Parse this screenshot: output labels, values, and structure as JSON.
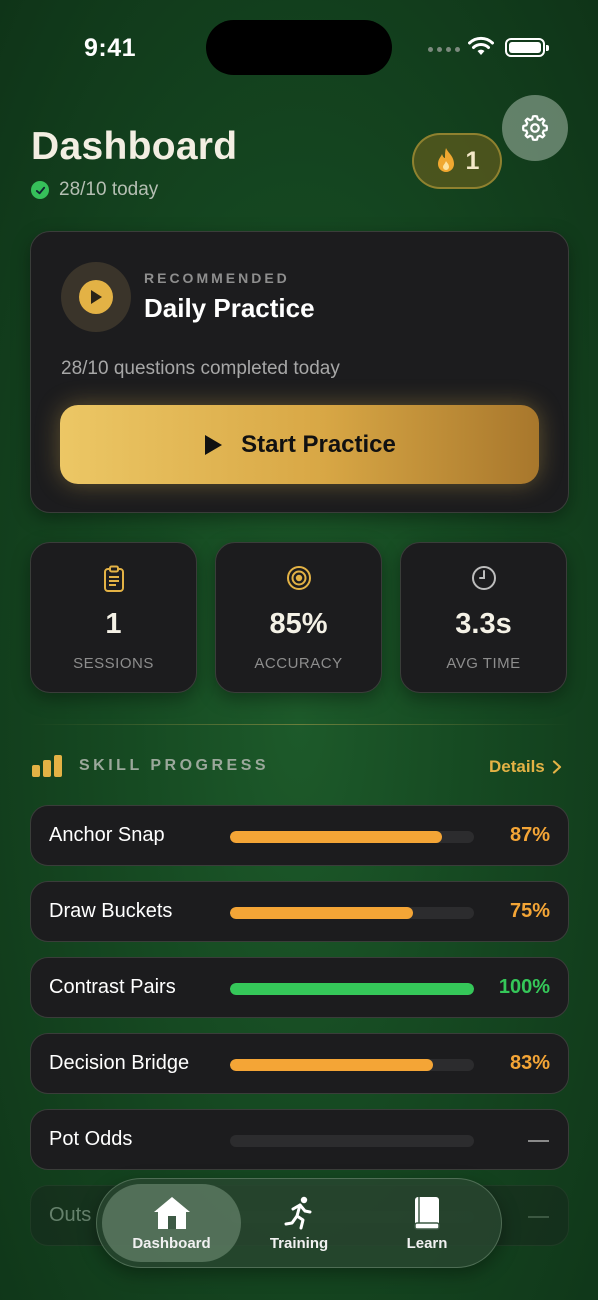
{
  "status_bar": {
    "time": "9:41"
  },
  "header": {
    "title": "Dashboard",
    "subtitle": "28/10 today",
    "streak_count": "1"
  },
  "recommended": {
    "eyebrow": "RECOMMENDED",
    "title": "Daily Practice",
    "description": "28/10 questions completed today",
    "button_label": "Start Practice"
  },
  "stats": [
    {
      "icon": "clipboard-icon",
      "value": "1",
      "label": "SESSIONS"
    },
    {
      "icon": "target-icon",
      "value": "85%",
      "label": "ACCURACY"
    },
    {
      "icon": "clock-icon",
      "value": "3.3s",
      "label": "AVG TIME"
    }
  ],
  "skill_progress": {
    "heading": "SKILL PROGRESS",
    "details_label": "Details",
    "skills": [
      {
        "name": "Anchor Snap",
        "progress": 0.87,
        "value": "87%",
        "color": "#f4a536"
      },
      {
        "name": "Draw Buckets",
        "progress": 0.75,
        "value": "75%",
        "color": "#f4a536"
      },
      {
        "name": "Contrast Pairs",
        "progress": 1.0,
        "value": "100%",
        "color": "#35c759"
      },
      {
        "name": "Decision Bridge",
        "progress": 0.83,
        "value": "83%",
        "color": "#f4a536"
      },
      {
        "name": "Pot Odds",
        "progress": 0,
        "value": "",
        "color": "#f4a536"
      },
      {
        "name": "Outs",
        "progress": 0,
        "value": "",
        "color": "#f4a536"
      }
    ]
  },
  "tabs": [
    {
      "label": "Dashboard",
      "icon": "house-icon",
      "active": true
    },
    {
      "label": "Training",
      "icon": "runner-icon",
      "active": false
    },
    {
      "label": "Learn",
      "icon": "book-icon",
      "active": false
    }
  ],
  "colors": {
    "accent_gold": "#e3b245",
    "progress_orange": "#f4a536",
    "progress_green": "#35c759",
    "card_bg": "#1c1c1e"
  }
}
